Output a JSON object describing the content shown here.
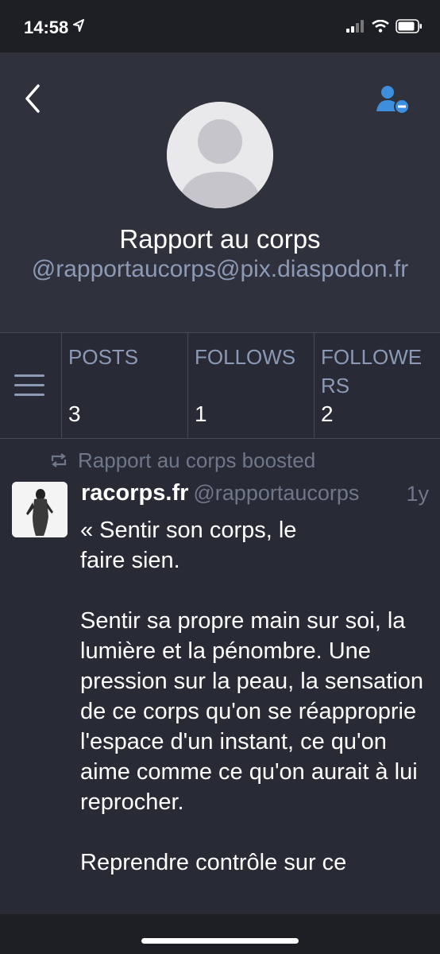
{
  "status_bar": {
    "time": "14:58"
  },
  "profile": {
    "display_name": "Rapport au corps",
    "handle": "@rapportaucorps@pix.diaspodon.fr"
  },
  "stats": [
    {
      "label": "POSTS",
      "value": "3"
    },
    {
      "label": "FOLLOWS",
      "value": "1"
    },
    {
      "label": "FOLLOWERS",
      "value": "2"
    }
  ],
  "post": {
    "boost_text": "Rapport au corps boosted",
    "author": "racorps.fr",
    "acct": "@rapportaucorps",
    "time": "1y",
    "paragraphs": [
      "« Sentir son corps, le\nfaire sien.",
      "Sentir sa propre main sur soi, la lumière et la pénombre. Une pression sur la peau, la sensation de ce corps qu'on se réapproprie l'espace d'un instant, ce qu'on aime comme ce qu'on aurait à lui reprocher.",
      "Reprendre contrôle sur ce"
    ]
  },
  "colors": {
    "background": "#282b36",
    "header_background": "#2f323c",
    "accent": "#3e8ede",
    "muted": "#8c9ab5"
  },
  "icons": [
    "location-arrow-icon",
    "signal-icon",
    "wifi-icon",
    "battery-icon",
    "chevron-left-icon",
    "unfollow-user-icon",
    "hamburger-menu-icon",
    "boost-icon"
  ]
}
